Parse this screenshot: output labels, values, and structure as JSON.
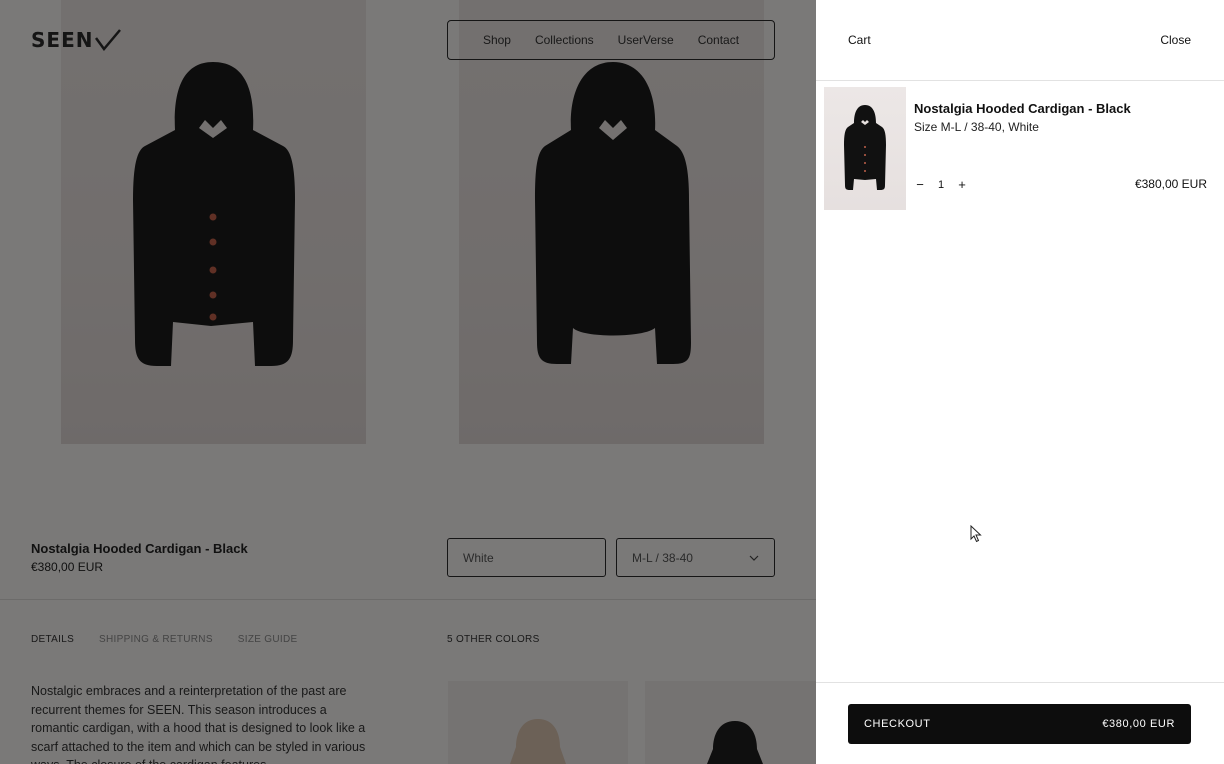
{
  "page": {
    "logo": "SEEN",
    "nav": [
      "Shop",
      "Collections",
      "UserVerse",
      "Contact"
    ],
    "product": {
      "title": "Nostalgia Hooded Cardigan - Black",
      "price": "€380,00 EUR",
      "color_value": "White",
      "size_value": "M-L / 38-40"
    },
    "tabs": [
      "DETAILS",
      "SHIPPING & RETURNS",
      "SIZE GUIDE"
    ],
    "other_colors": "5 OTHER COLORS",
    "description": "Nostalgic embraces and a reinterpretation of the past are recurrent themes for SEEN. This season introduces a romantic cardigan, with a hood that is designed to look like a scarf attached to the item and which can be styled in various ways. The closure of the cardigan features"
  },
  "cart": {
    "title": "Cart",
    "close_label": "Close",
    "items": [
      {
        "name": "Nostalgia Hooded Cardigan - Black",
        "variant": "Size M-L / 38-40, White",
        "quantity": "1",
        "price": "€380,00 EUR",
        "decrement": "−",
        "increment": "+"
      }
    ],
    "checkout_label": "CHECKOUT",
    "checkout_total": "€380,00 EUR"
  },
  "colors": {
    "overlay": "rgba(0,0,0,0.5)",
    "checkout_bg": "#0d0d0d",
    "garment": "#1a1a1a",
    "buttons": "#c0614a"
  }
}
